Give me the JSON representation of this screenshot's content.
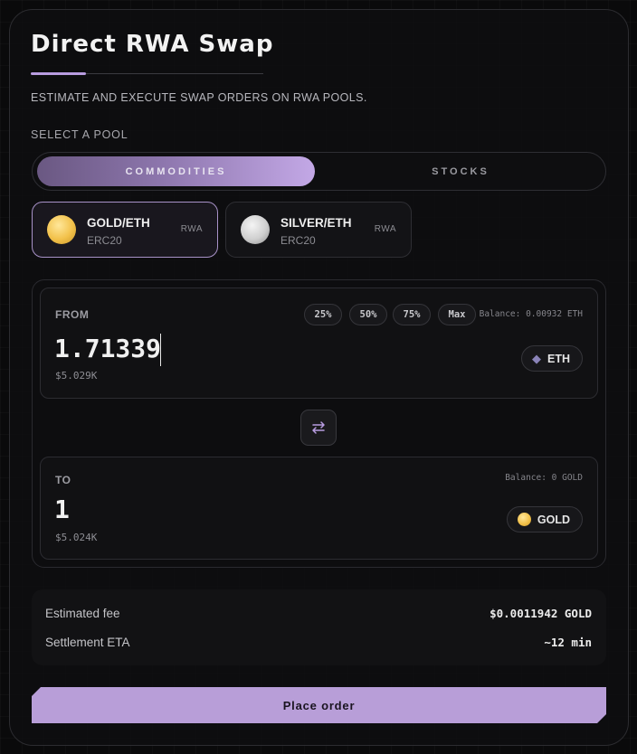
{
  "header": {
    "title": "Direct RWA Swap",
    "subtitle": "ESTIMATE AND EXECUTE SWAP ORDERS ON RWA POOLS.",
    "accent_color": "#b89ce0"
  },
  "pool_select": {
    "label": "SELECT A POOL",
    "tabs": [
      {
        "label": "COMMODITIES",
        "active": true
      },
      {
        "label": "STOCKS",
        "active": false
      }
    ],
    "pools": [
      {
        "name": "GOLD/ETH",
        "standard": "ERC20",
        "tag": "RWA",
        "icon": "gold-coin-icon",
        "selected": true
      },
      {
        "name": "SILVER/ETH",
        "standard": "ERC20",
        "tag": "RWA",
        "icon": "silver-coin-icon",
        "selected": false
      }
    ]
  },
  "from": {
    "label": "FROM",
    "amount": "1.71339",
    "usd_value": "$5.029K",
    "percent_buttons": [
      "25%",
      "50%",
      "75%",
      "Max"
    ],
    "balance": "Balance: 0.00932 ETH",
    "token": "ETH",
    "token_icon": "ethereum-icon"
  },
  "to": {
    "label": "TO",
    "amount": "1",
    "usd_value": "$5.024K",
    "balance": "Balance: 0 GOLD",
    "token": "GOLD",
    "token_icon": "gold-coin-icon"
  },
  "swap_direction_icon": "swap-arrows-icon",
  "summary": {
    "fee_label": "Estimated fee",
    "fee_value": "$0.0011942 GOLD",
    "eta_label": "Settlement ETA",
    "eta_value": "~12 min"
  },
  "action": {
    "place_order_label": "Place order",
    "button_color": "#b89ed8"
  }
}
